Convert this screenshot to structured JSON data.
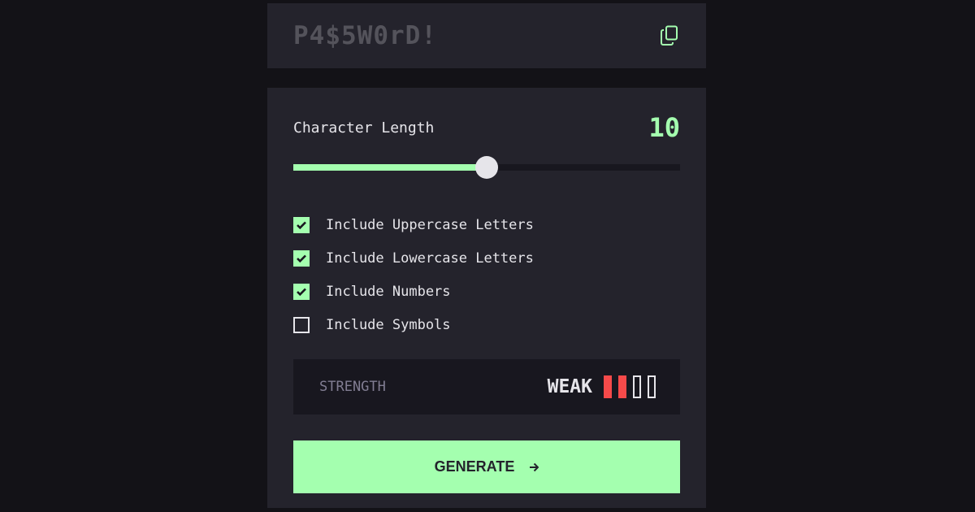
{
  "colors": {
    "accent": "#a4ffaf",
    "panel": "#24232c",
    "page": "#131217",
    "strength_weak": "#f64a4a"
  },
  "password": {
    "placeholder": "P4$5W0rD!",
    "copy_icon": "copy-icon"
  },
  "length": {
    "label": "Character Length",
    "value": "10",
    "slider_fraction": 0.5
  },
  "options": [
    {
      "label": "Include Uppercase Letters",
      "checked": true
    },
    {
      "label": "Include Lowercase Letters",
      "checked": true
    },
    {
      "label": "Include Numbers",
      "checked": true
    },
    {
      "label": "Include Symbols",
      "checked": false
    }
  ],
  "strength": {
    "label": "STRENGTH",
    "word": "WEAK",
    "level": 2,
    "max": 4
  },
  "generate": {
    "label": "GENERATE",
    "icon": "arrow-right-icon"
  }
}
